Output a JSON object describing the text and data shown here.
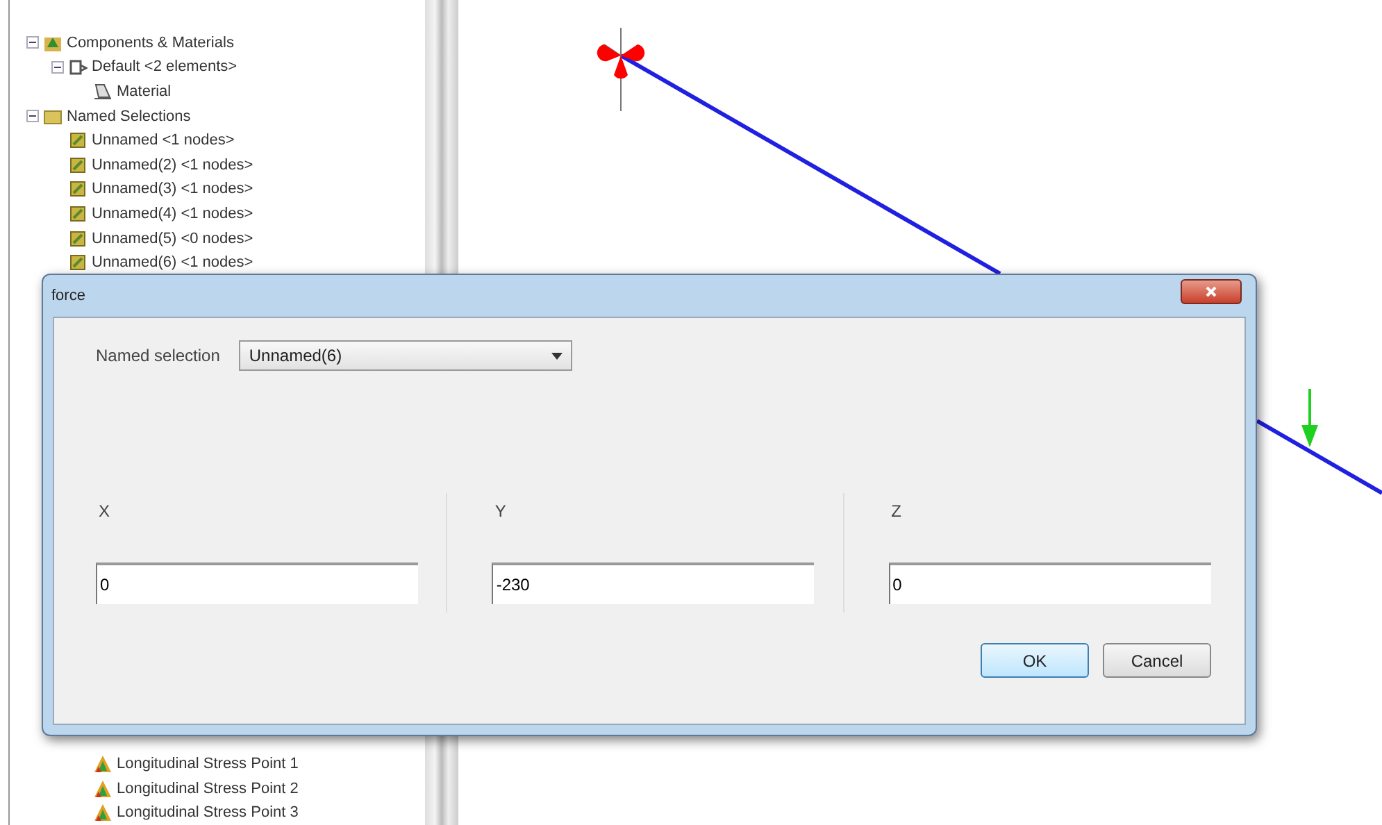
{
  "tree_top": [
    {
      "label": "Components & Materials",
      "kind": "components",
      "children": [
        {
          "label": "Default <2 elements>",
          "kind": "part",
          "children": [
            {
              "label": "Material",
              "kind": "material"
            }
          ]
        }
      ]
    },
    {
      "label": "Named Selections",
      "kind": "folder",
      "children": [
        {
          "label": "Unnamed <1 nodes>",
          "kind": "selection"
        },
        {
          "label": "Unnamed(2) <1 nodes>",
          "kind": "selection"
        },
        {
          "label": "Unnamed(3) <1 nodes>",
          "kind": "selection"
        },
        {
          "label": "Unnamed(4) <1 nodes>",
          "kind": "selection"
        },
        {
          "label": "Unnamed(5) <0 nodes>",
          "kind": "selection"
        },
        {
          "label": "Unnamed(6) <1 nodes>",
          "kind": "selection"
        }
      ]
    }
  ],
  "tree_bottom": [
    {
      "label": "Longitudinal Stress Point 1",
      "kind": "result"
    },
    {
      "label": "Longitudinal Stress Point 2",
      "kind": "result"
    },
    {
      "label": "Longitudinal Stress Point 3",
      "kind": "result"
    }
  ],
  "dialog": {
    "title": "force",
    "named_selection": {
      "label": "Named selection",
      "value": "Unnamed(6)"
    },
    "components": [
      {
        "label": "X",
        "value": "0"
      },
      {
        "label": "Y",
        "value": "-230"
      },
      {
        "label": "Z",
        "value": "0"
      }
    ],
    "buttons": [
      {
        "label": "OK",
        "default": true
      },
      {
        "label": "Cancel",
        "default": false
      }
    ]
  }
}
